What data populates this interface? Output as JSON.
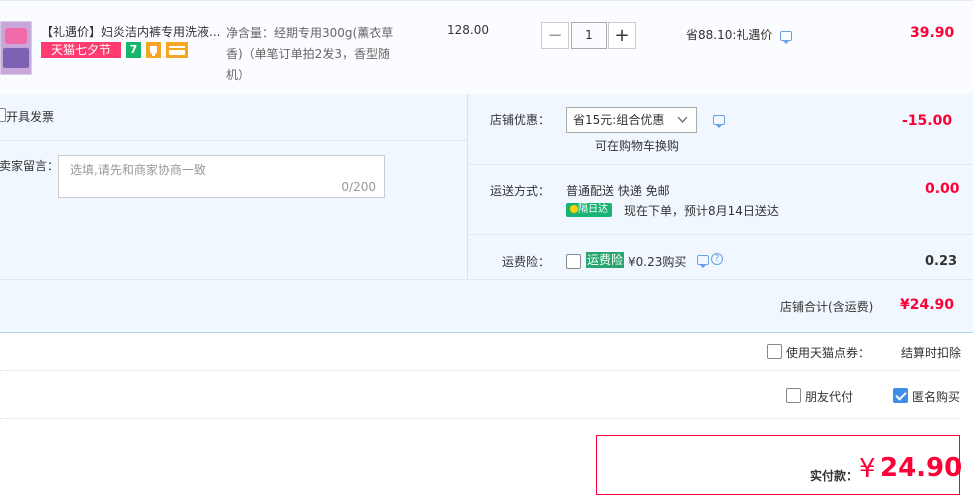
{
  "item": {
    "title": "【礼遇价】妇炎洁内裤专用洗液...",
    "tag": "天猫七夕节",
    "icon7": "7",
    "sku": "净含量：经期专用300g(薰衣草香)（单笔订单拍2发3，香型随机）",
    "unit_price": "128.00",
    "quantity": "1",
    "minus": "−",
    "plus": "+",
    "save_text": "省88.10:礼遇价",
    "subtotal": "39.90"
  },
  "invoice": {
    "label": "开具发票"
  },
  "message": {
    "label": "卖家留言：",
    "placeholder": "选填,请先和商家协商一致",
    "counter": "0/200"
  },
  "shop_discount": {
    "label": "店铺优惠：",
    "selected": "省15元:组合优惠",
    "note": "可在购物车换购",
    "amount": "-15.00"
  },
  "shipping": {
    "label": "运送方式：",
    "method": "普通配送 快递 免邮",
    "badge": "隔日达",
    "eta": "现在下单，预计8月14日送达",
    "amount": "0.00"
  },
  "insurance": {
    "label": "运费险：",
    "tag": "运费险",
    "price": "¥0.23购买",
    "amount": "0.23"
  },
  "shop_total": {
    "label": "店铺合计(含运费)",
    "amount": "¥24.90"
  },
  "coupon": {
    "label": "使用天猫点券：",
    "note": "结算时扣除"
  },
  "options": {
    "friend_pay": "朋友代付",
    "anonymous": "匿名购买"
  },
  "payment": {
    "label": "实付款：",
    "currency": "¥",
    "amount": "24.90"
  },
  "colors": {
    "accent": "#ff0036",
    "tag_pink": "#ff3b70",
    "panel": "#f1f7ff",
    "link_blue": "#3c8ee8"
  }
}
